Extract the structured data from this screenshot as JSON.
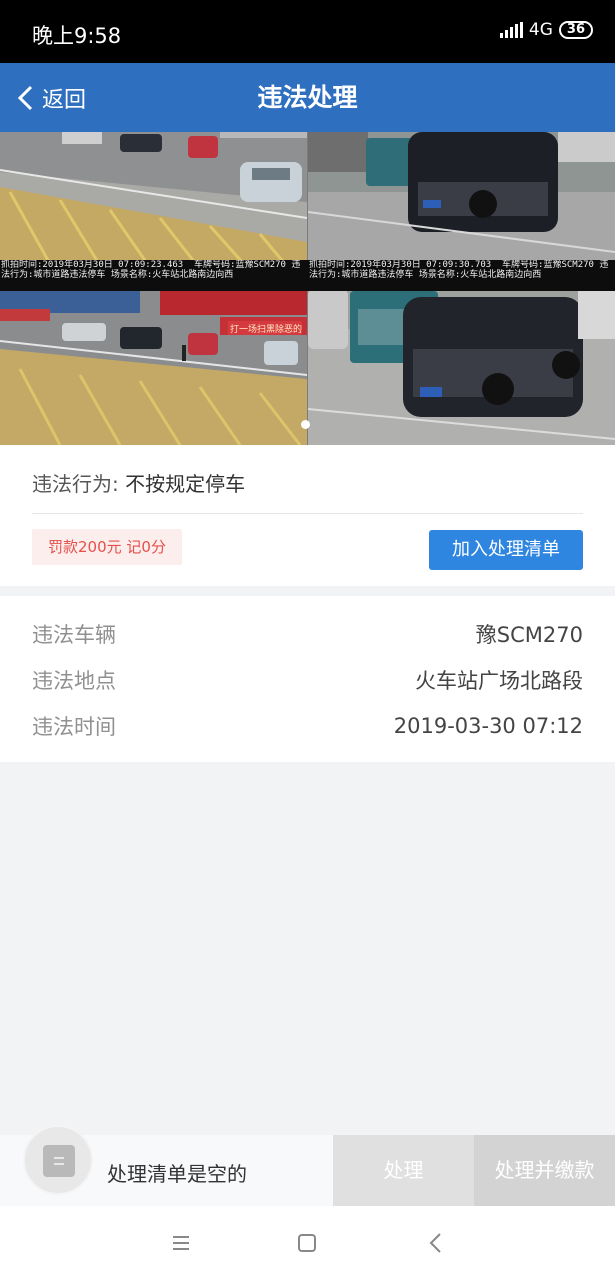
{
  "status_bar": {
    "time": "晚上9:58",
    "network": "4G",
    "battery": "36"
  },
  "nav": {
    "back_label": "返回",
    "title": "违法处理"
  },
  "photos": {
    "captions": [
      "抓拍时间:2019年03月30日 07:09:23.463  车牌号码:蓝豫SCM270 违法行为:城市道路违法停车 场景名称:火车站北路南边向西",
      "抓拍时间:2019年03月30日 07:09:30.703  车牌号码:蓝豫SCM270 违法行为:城市道路违法停车 场景名称:火车站北路南边向西"
    ],
    "banner_text": "打一场扫黑除恶的"
  },
  "violation": {
    "behavior_label": "违法行为:",
    "behavior_value": "不按规定停车",
    "fine_tag": "罚款200元 记0分",
    "add_button": "加入处理清单"
  },
  "details": [
    {
      "label": "违法车辆",
      "value": "豫SCM270"
    },
    {
      "label": "违法地点",
      "value": "火车站广场北路段"
    },
    {
      "label": "违法时间",
      "value": "2019-03-30 07:12"
    }
  ],
  "bottom_bar": {
    "empty_text": "处理清单是空的",
    "process_button": "处理",
    "process_pay_button": "处理并缴款"
  },
  "colors": {
    "nav_blue": "#2f6fc0",
    "button_blue": "#2f86e0",
    "fine_red": "#e5504a",
    "fine_bg": "#fdeeee"
  },
  "icons": {
    "back": "chevron-left-icon",
    "cart": "list-icon",
    "menu": "menu-icon",
    "home": "square-icon",
    "system_back": "chevron-left-icon"
  }
}
